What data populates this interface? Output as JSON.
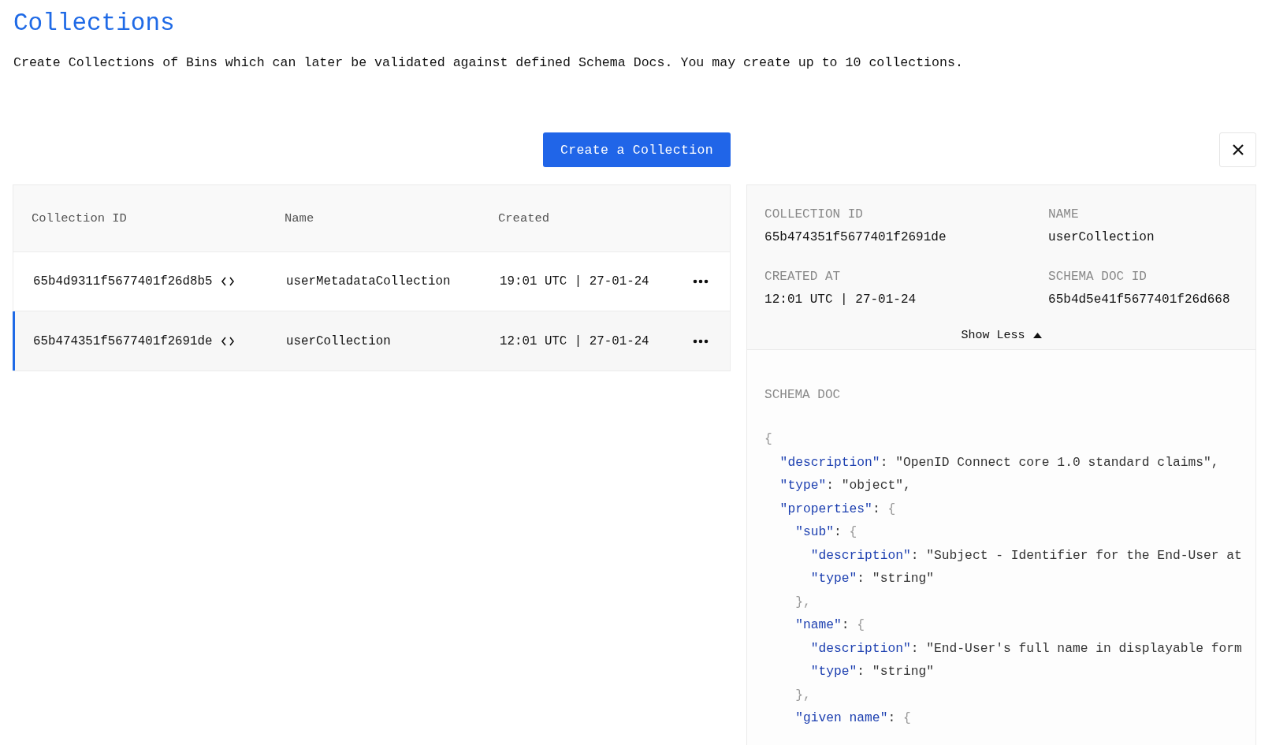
{
  "page": {
    "title": "Collections",
    "description": "Create Collections of Bins which can later be validated against defined Schema Docs. You may create up to 10 collections."
  },
  "create_button": {
    "label": "Create a Collection"
  },
  "table": {
    "columns": [
      "Collection ID",
      "Name",
      "Created"
    ],
    "rows": [
      {
        "id": "65b4d9311f5677401f26d8b5",
        "name": "userMetadataCollection",
        "created": "19:01 UTC | 27-01-24",
        "selected": false
      },
      {
        "id": "65b474351f5677401f2691de",
        "name": "userCollection",
        "created": "12:01 UTC | 27-01-24",
        "selected": true
      }
    ]
  },
  "details": {
    "fields": [
      {
        "label": "COLLECTION ID",
        "value": "65b474351f5677401f2691de"
      },
      {
        "label": "NAME",
        "value": "userCollection"
      },
      {
        "label": "CREATED AT",
        "value": "12:01 UTC | 27-01-24"
      },
      {
        "label": "SCHEMA DOC ID",
        "value": "65b4d5e41f5677401f26d668"
      }
    ],
    "toggle": {
      "label": "Show Less",
      "expanded": true
    },
    "schema_title": "SCHEMA DOC",
    "schema_lines": [
      [
        {
          "kind": "punct",
          "text": "{"
        }
      ],
      [
        {
          "kind": "key",
          "text": "  \"description\""
        },
        {
          "kind": "plain",
          "text": ": \"OpenID Connect core 1.0 standard claims\","
        }
      ],
      [
        {
          "kind": "key",
          "text": "  \"type\""
        },
        {
          "kind": "plain",
          "text": ": \"object\","
        }
      ],
      [
        {
          "kind": "key",
          "text": "  \"properties\""
        },
        {
          "kind": "plain",
          "text": ": "
        },
        {
          "kind": "punct",
          "text": "{"
        }
      ],
      [
        {
          "kind": "key",
          "text": "    \"sub\""
        },
        {
          "kind": "plain",
          "text": ": "
        },
        {
          "kind": "punct",
          "text": "{"
        }
      ],
      [
        {
          "kind": "key",
          "text": "      \"description\""
        },
        {
          "kind": "plain",
          "text": ": \"Subject - Identifier for the End-User at"
        }
      ],
      [
        {
          "kind": "key",
          "text": "      \"type\""
        },
        {
          "kind": "plain",
          "text": ": \"string\""
        }
      ],
      [
        {
          "kind": "punct",
          "text": "    },"
        }
      ],
      [
        {
          "kind": "key",
          "text": "    \"name\""
        },
        {
          "kind": "plain",
          "text": ": "
        },
        {
          "kind": "punct",
          "text": "{"
        }
      ],
      [
        {
          "kind": "key",
          "text": "      \"description\""
        },
        {
          "kind": "plain",
          "text": ": \"End-User's full name in displayable form"
        }
      ],
      [
        {
          "kind": "key",
          "text": "      \"type\""
        },
        {
          "kind": "plain",
          "text": ": \"string\""
        }
      ],
      [
        {
          "kind": "punct",
          "text": "    },"
        }
      ],
      [
        {
          "kind": "key",
          "text": "    \"given name\""
        },
        {
          "kind": "plain",
          "text": ": "
        },
        {
          "kind": "punct",
          "text": "{"
        }
      ]
    ]
  }
}
